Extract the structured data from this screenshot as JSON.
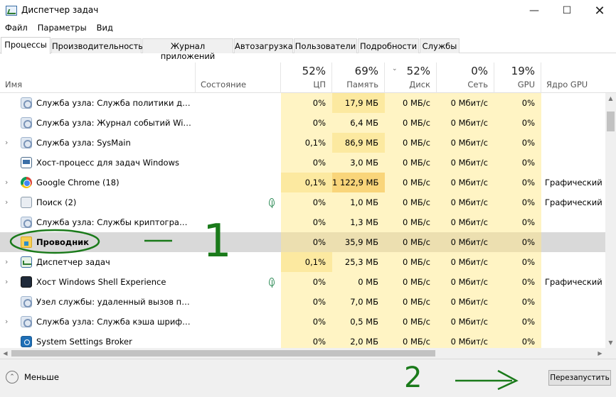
{
  "window": {
    "title": "Диспетчер задач",
    "minimize": "—",
    "maximize": "☐",
    "close": "✕"
  },
  "menu": [
    "Файл",
    "Параметры",
    "Вид"
  ],
  "tabs": [
    "Процессы",
    "Производительность",
    "Журнал приложений",
    "Автозагрузка",
    "Пользователи",
    "Подробности",
    "Службы"
  ],
  "active_tab": "Процессы",
  "columns": {
    "name": "Имя",
    "status": "Состояние",
    "cpu": {
      "pct": "52%",
      "label": "ЦП"
    },
    "memory": {
      "pct": "69%",
      "label": "Память"
    },
    "disk": {
      "pct": "52%",
      "label": "Диск"
    },
    "network": {
      "pct": "0%",
      "label": "Сеть"
    },
    "gpu": {
      "pct": "19%",
      "label": "GPU"
    },
    "gpu_engine": "Ядро GPU"
  },
  "processes": [
    {
      "name": "Служба узла: Служба политики диагн...",
      "cpu": "0%",
      "mem": "17,9 МБ",
      "disk": "0 МБ/с",
      "net": "0 Мбит/с",
      "gpu": "0%",
      "engine": ""
    },
    {
      "name": "Служба узла: Журнал событий Windo...",
      "cpu": "0%",
      "mem": "6,4 МБ",
      "disk": "0 МБ/с",
      "net": "0 Мбит/с",
      "gpu": "0%",
      "engine": ""
    },
    {
      "name": "Служба узла: SysMain",
      "cpu": "0,1%",
      "mem": "86,9 МБ",
      "disk": "0 МБ/с",
      "net": "0 Мбит/с",
      "gpu": "0%",
      "engine": ""
    },
    {
      "name": "Хост-процесс для задач Windows",
      "cpu": "0%",
      "mem": "3,0 МБ",
      "disk": "0 МБ/с",
      "net": "0 Мбит/с",
      "gpu": "0%",
      "engine": ""
    },
    {
      "name": "Google Chrome (18)",
      "cpu": "0,1%",
      "mem": "1 122,9 МБ",
      "disk": "0 МБ/с",
      "net": "0 Мбит/с",
      "gpu": "0%",
      "engine": "Графический п"
    },
    {
      "name": "Поиск (2)",
      "cpu": "0%",
      "mem": "1,0 МБ",
      "disk": "0 МБ/с",
      "net": "0 Мбит/с",
      "gpu": "0%",
      "engine": "Графический п"
    },
    {
      "name": "Служба узла: Службы криптографии",
      "cpu": "0%",
      "mem": "1,3 МБ",
      "disk": "0 МБ/с",
      "net": "0 Мбит/с",
      "gpu": "0%",
      "engine": ""
    },
    {
      "name": "Проводник",
      "cpu": "0%",
      "mem": "35,9 МБ",
      "disk": "0 МБ/с",
      "net": "0 Мбит/с",
      "gpu": "0%",
      "engine": ""
    },
    {
      "name": "Диспетчер задач",
      "cpu": "0,1%",
      "mem": "25,3 МБ",
      "disk": "0 МБ/с",
      "net": "0 Мбит/с",
      "gpu": "0%",
      "engine": ""
    },
    {
      "name": "Хост Windows Shell Experience",
      "cpu": "0%",
      "mem": "0 МБ",
      "disk": "0 МБ/с",
      "net": "0 Мбит/с",
      "gpu": "0%",
      "engine": "Графический п"
    },
    {
      "name": "Узел службы: удаленный вызов проц...",
      "cpu": "0%",
      "mem": "7,0 МБ",
      "disk": "0 МБ/с",
      "net": "0 Мбит/с",
      "gpu": "0%",
      "engine": ""
    },
    {
      "name": "Служба узла: Служба кэша шрифтов ...",
      "cpu": "0%",
      "mem": "0,5 МБ",
      "disk": "0 МБ/с",
      "net": "0 Мбит/с",
      "gpu": "0%",
      "engine": ""
    },
    {
      "name": "System Settings Broker",
      "cpu": "0%",
      "mem": "2,0 МБ",
      "disk": "0 МБ/с",
      "net": "0 Мбит/с",
      "gpu": "0%",
      "engine": ""
    }
  ],
  "footer": {
    "less_label": "Меньше",
    "restart_label": "Перезапустить"
  },
  "annotations": {
    "mark_1": "1",
    "mark_2": "2",
    "color": "#1a7a1a"
  },
  "colors": {
    "heat_light": "#fff4c4",
    "heat_medium": "#fce9a0",
    "heat_high": "#f9d57a",
    "selected_row": "#d9d9d9"
  }
}
